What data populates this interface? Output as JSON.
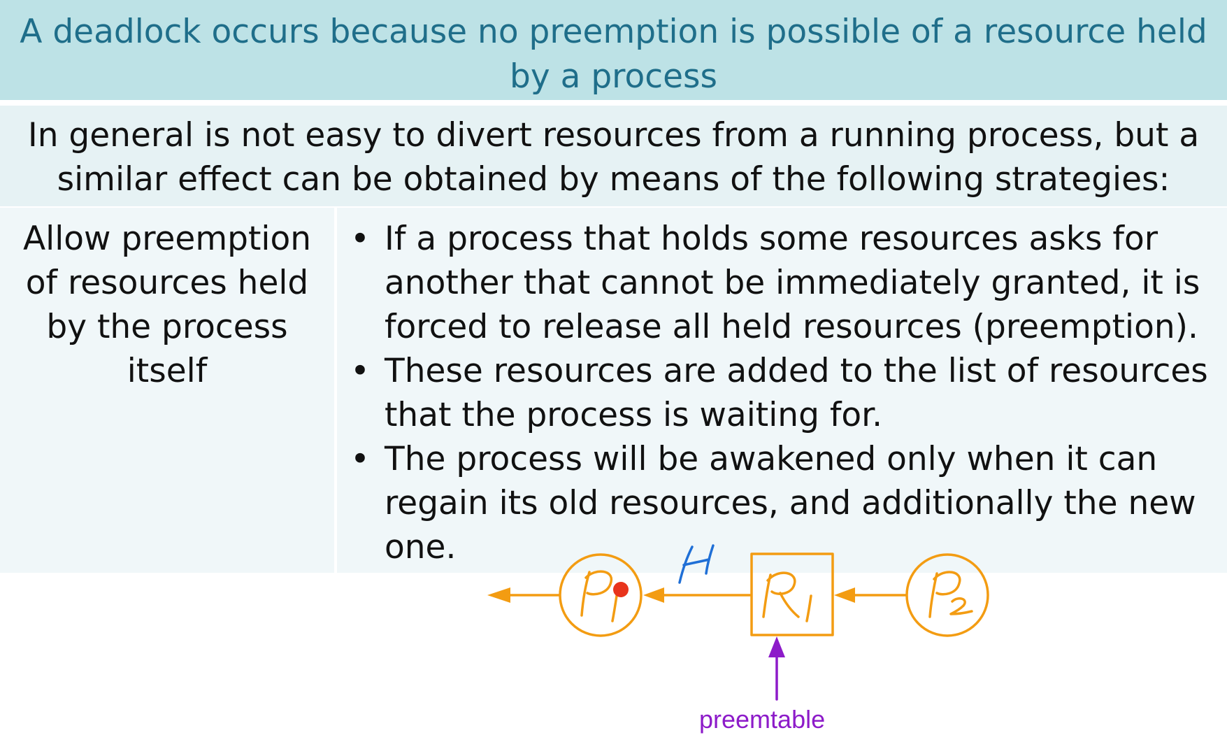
{
  "title": {
    "line1": "A deadlock occurs because no preemption is possible of a resource held",
    "line2": "by a process"
  },
  "intro": {
    "line1": "In general is not easy to divert resources from a running process, but a",
    "line2": "similar effect can be obtained by means of the following strategies:"
  },
  "strategy": {
    "label_lines": [
      "Allow preemption",
      "of resources held",
      "by the process",
      "itself"
    ],
    "bullets": [
      {
        "lines": [
          "If a process that holds some resources asks for",
          "another that cannot be immediately granted, it is",
          "forced to release all held resources (preemption)."
        ]
      },
      {
        "lines": [
          "These resources are added to the list of resources",
          "that the process is waiting for."
        ]
      },
      {
        "lines": [
          "The process will be awakened only when it can",
          "regain its old resources, and additionally the new",
          "one."
        ]
      }
    ]
  },
  "annotation": {
    "nodes": [
      "P1",
      "R1",
      "P2"
    ],
    "edge_label": "H",
    "preempt_label": "preemtable",
    "colors": {
      "node": "#f39c12",
      "edge_label": "#1f6fd6",
      "preempt": "#8d1bc9",
      "marker": "#e8341c"
    }
  }
}
